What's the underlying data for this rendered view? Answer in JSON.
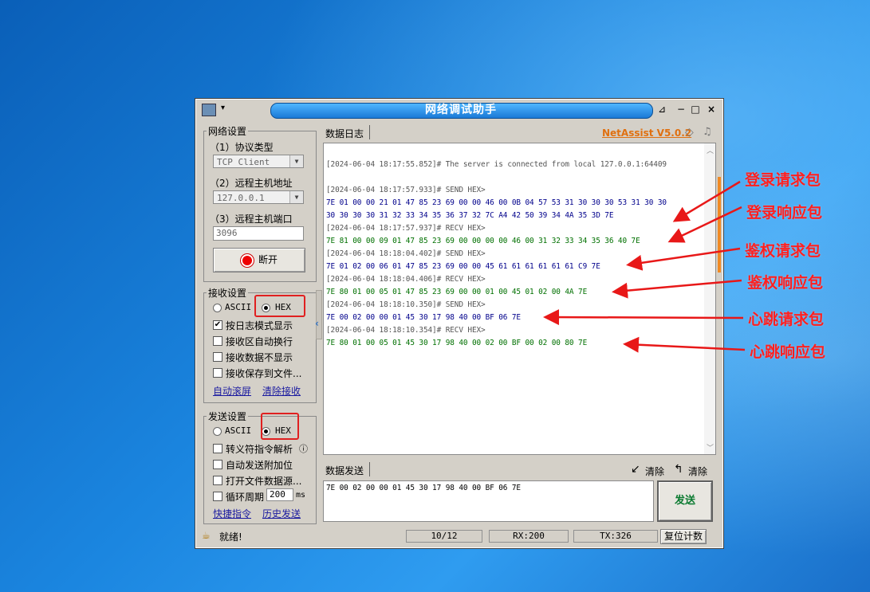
{
  "window": {
    "title": "网络调试助手",
    "close": "×",
    "maximize": "□",
    "minimize": "−",
    "pin": "⊿"
  },
  "net_settings": {
    "group": "网络设置",
    "protocol_label": "（1）协议类型",
    "protocol_value": "TCP Client",
    "host_label": "（2）远程主机地址",
    "host_value": "127.0.0.1",
    "port_label": "（3）远程主机端口",
    "port_value": "3096",
    "disconnect_button": "断开"
  },
  "recv_settings": {
    "group": "接收设置",
    "ascii": "ASCII",
    "hex": "HEX",
    "selected": "HEX",
    "options": [
      {
        "label": "按日志模式显示",
        "checked": true
      },
      {
        "label": "接收区自动换行",
        "checked": false
      },
      {
        "label": "接收数据不显示",
        "checked": false
      },
      {
        "label": "接收保存到文件...",
        "checked": false
      }
    ],
    "link_autoscroll": "自动滚屏",
    "link_clear": "清除接收"
  },
  "send_settings": {
    "group": "发送设置",
    "ascii": "ASCII",
    "hex": "HEX",
    "selected": "HEX",
    "options": [
      {
        "label": "转义符指令解析",
        "checked": false
      },
      {
        "label": "自动发送附加位",
        "checked": false
      },
      {
        "label": "打开文件数据源...",
        "checked": false
      },
      {
        "label": "循环周期",
        "checked": false
      }
    ],
    "cycle_value": "200",
    "cycle_unit": "ms",
    "link_shortcut": "快捷指令",
    "link_history": "历史发送"
  },
  "log_panel": {
    "tab": "数据日志",
    "brand": "NetAssist V5.0.2",
    "lines": [
      {
        "text": "[2024-06-04 18:17:55.852]# The server is connected from local 127.0.0.1:64409",
        "color": "#555555"
      },
      {
        "text": "[2024-06-04 18:17:57.933]# SEND HEX>",
        "color": "#555555"
      },
      {
        "text": "7E 01 00 00 21 01 47 85 23 69 00 00 46 00 0B 04 57 53 31 30 30 30 53 31 30 30",
        "color": "#00008b"
      },
      {
        "text": "30 30 30 30 31 32 33 34 35 36 37 32 7C A4 42 50 39 34 4A 35 3D 7E",
        "color": "#00008b"
      },
      {
        "text": "[2024-06-04 18:17:57.937]# RECV HEX>",
        "color": "#555555"
      },
      {
        "text": "7E 81 00 00 09 01 47 85 23 69 00 00 00 00 46 00 31 32 33 34 35 36 40 7E",
        "color": "#007000"
      },
      {
        "text": "[2024-06-04 18:18:04.402]# SEND HEX>",
        "color": "#555555"
      },
      {
        "text": "7E 01 02 00 06 01 47 85 23 69 00 00 45 61 61 61 61 61 61 C9 7E",
        "color": "#00008b"
      },
      {
        "text": "[2024-06-04 18:18:04.406]# RECV HEX>",
        "color": "#555555"
      },
      {
        "text": "7E 80 01 00 05 01 47 85 23 69 00 00 01 00 45 01 02 00 4A 7E",
        "color": "#007000"
      },
      {
        "text": "[2024-06-04 18:18:10.350]# SEND HEX>",
        "color": "#555555"
      },
      {
        "text": "7E 00 02 00 00 01 45 30 17 98 40 00 BF 06 7E",
        "color": "#00008b"
      },
      {
        "text": "[2024-06-04 18:18:10.354]# RECV HEX>",
        "color": "#555555"
      },
      {
        "text": "7E 80 01 00 05 01 45 30 17 98 40 00 02 00 BF 00 02 00 80 7E",
        "color": "#007000"
      }
    ]
  },
  "send_panel": {
    "tab": "数据发送",
    "clear1": "清除",
    "clear2": "清除",
    "content": "7E 00 02 00 00 01 45 30 17 98 40 00 BF 06 7E",
    "send_button": "发送"
  },
  "status_bar": {
    "status": "就绪!",
    "counter": "10/12",
    "rx": "RX:200",
    "tx": "TX:326",
    "reset": "复位计数"
  },
  "annotations": [
    "登录请求包",
    "登录响应包",
    "鉴权请求包",
    "鉴权响应包",
    "心跳请求包",
    "心跳响应包"
  ]
}
